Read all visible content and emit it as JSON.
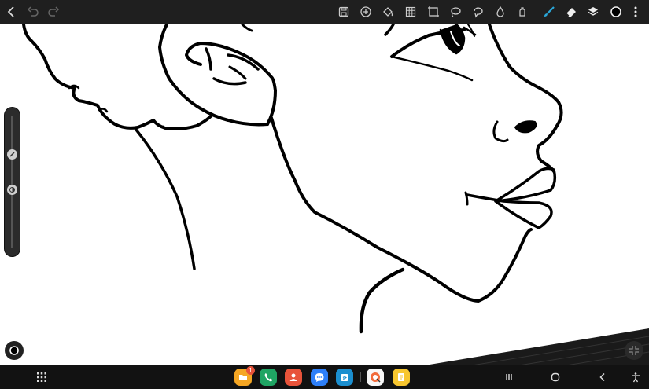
{
  "toolbar": {
    "left": [
      {
        "icon": "back-chevron-icon"
      },
      {
        "icon": "undo-icon"
      },
      {
        "icon": "redo-icon"
      }
    ],
    "tools": [
      {
        "icon": "save-icon"
      },
      {
        "icon": "add-icon"
      },
      {
        "icon": "fill-bucket-icon"
      },
      {
        "icon": "grid-icon"
      },
      {
        "icon": "crop-icon"
      },
      {
        "icon": "lasso-icon"
      },
      {
        "icon": "lasso-fill-icon"
      },
      {
        "icon": "blur-drop-icon"
      },
      {
        "icon": "smudge-icon"
      },
      {
        "icon": "brush-icon",
        "active": true
      },
      {
        "icon": "eraser-icon"
      },
      {
        "icon": "layers-icon"
      },
      {
        "icon": "color-circle-icon"
      },
      {
        "icon": "more-vertical-icon"
      }
    ],
    "accent": "#2aa7d9"
  },
  "side_slider": {
    "brush_size_level": 0.3,
    "opacity_level": 0.55
  },
  "taskbar": {
    "apps": [
      {
        "icon": "files-app-icon",
        "color": "#f5a623",
        "badge": "1"
      },
      {
        "icon": "phone-app-icon",
        "color": "#1fa463"
      },
      {
        "icon": "contacts-app-icon",
        "color": "#e8533a"
      },
      {
        "icon": "messages-app-icon",
        "color": "#2d7ff9"
      },
      {
        "icon": "store-app-icon",
        "color": "#1b8fd0"
      },
      {
        "icon": "drawing-app-icon",
        "color": "#f7f7f7"
      },
      {
        "icon": "notes-app-icon",
        "color": "#f7c62f"
      }
    ],
    "nav": [
      {
        "icon": "recents-icon"
      },
      {
        "icon": "home-icon"
      },
      {
        "icon": "back-icon"
      },
      {
        "icon": "accessibility-icon"
      }
    ]
  }
}
